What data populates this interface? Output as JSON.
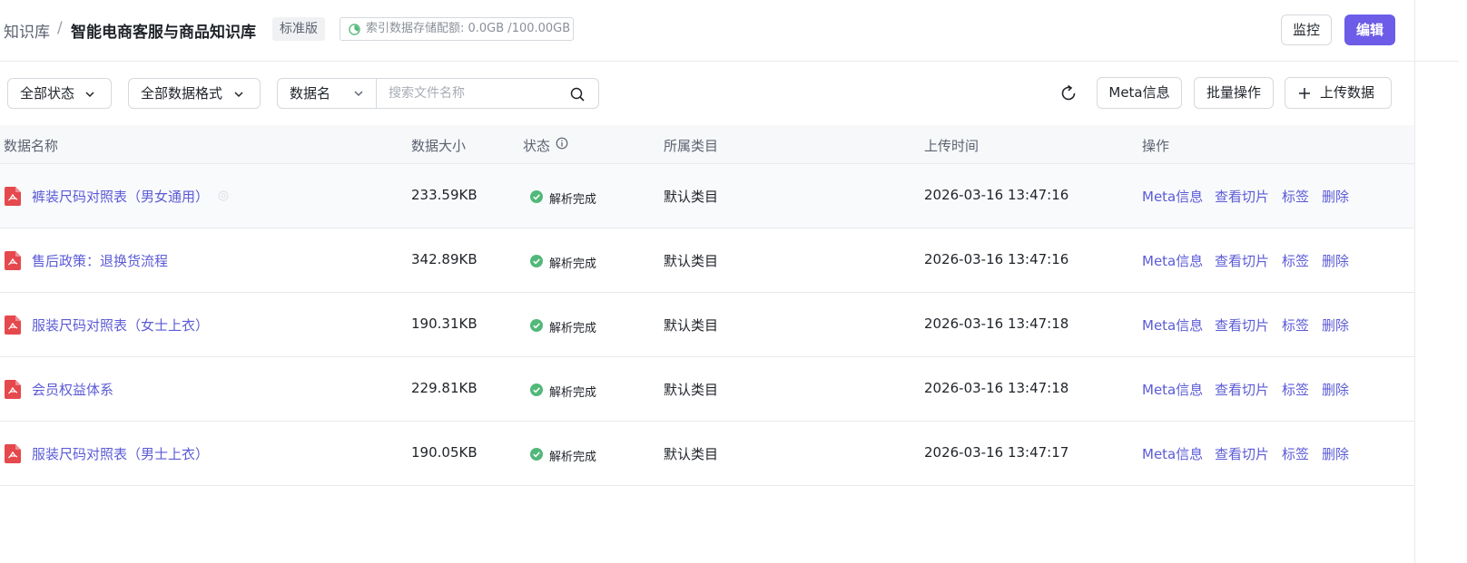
{
  "header": {
    "breadcrumb_root": "知识库",
    "breadcrumb_separator": "/",
    "breadcrumb_current": "智能电商客服与商品知识库",
    "edition_badge": "标准版",
    "quota_label": "索引数据存储配额: 0.0GB /100.00GB",
    "monitor_button": "监控",
    "edit_button": "编辑"
  },
  "toolbar": {
    "status_filter": "全部状态",
    "format_filter": "全部数据格式",
    "search_field": "数据名",
    "search_placeholder": "搜索文件名称",
    "meta_button": "Meta信息",
    "batch_button": "批量操作",
    "upload_button": "上传数据"
  },
  "table": {
    "columns": {
      "name": "数据名称",
      "size": "数据大小",
      "status": "状态",
      "category": "所属类目",
      "upload_time": "上传时间",
      "actions": "操作"
    },
    "actions": {
      "meta": "Meta信息",
      "slices": "查看切片",
      "tags": "标签",
      "delete": "删除"
    },
    "rows": [
      {
        "name": "裤装尺码对照表（男女通用）",
        "size": "233.59KB",
        "status": "解析完成",
        "category": "默认类目",
        "upload_time": "2026-03-16 13:47:16"
      },
      {
        "name": "售后政策：退换货流程",
        "size": "342.89KB",
        "status": "解析完成",
        "category": "默认类目",
        "upload_time": "2026-03-16 13:47:16"
      },
      {
        "name": "服装尺码对照表（女士上衣）",
        "size": "190.31KB",
        "status": "解析完成",
        "category": "默认类目",
        "upload_time": "2026-03-16 13:47:18"
      },
      {
        "name": "会员权益体系",
        "size": "229.81KB",
        "status": "解析完成",
        "category": "默认类目",
        "upload_time": "2026-03-16 13:47:18"
      },
      {
        "name": "服装尺码对照表（男士上衣）",
        "size": "190.05KB",
        "status": "解析完成",
        "category": "默认类目",
        "upload_time": "2026-03-16 13:47:17"
      }
    ]
  },
  "colors": {
    "accent": "#6c5ce7",
    "link": "#5b5bd6",
    "status_success": "#52b87a",
    "pdf_icon": "#e5484d"
  },
  "icons": {
    "file": "pdf-icon",
    "status": "check-circle-icon",
    "refresh": "refresh-icon",
    "search": "search-icon",
    "upload": "plus-icon",
    "quota": "pie-chart-icon",
    "dropdown": "chevron-down-icon",
    "column_info": "info-icon"
  }
}
